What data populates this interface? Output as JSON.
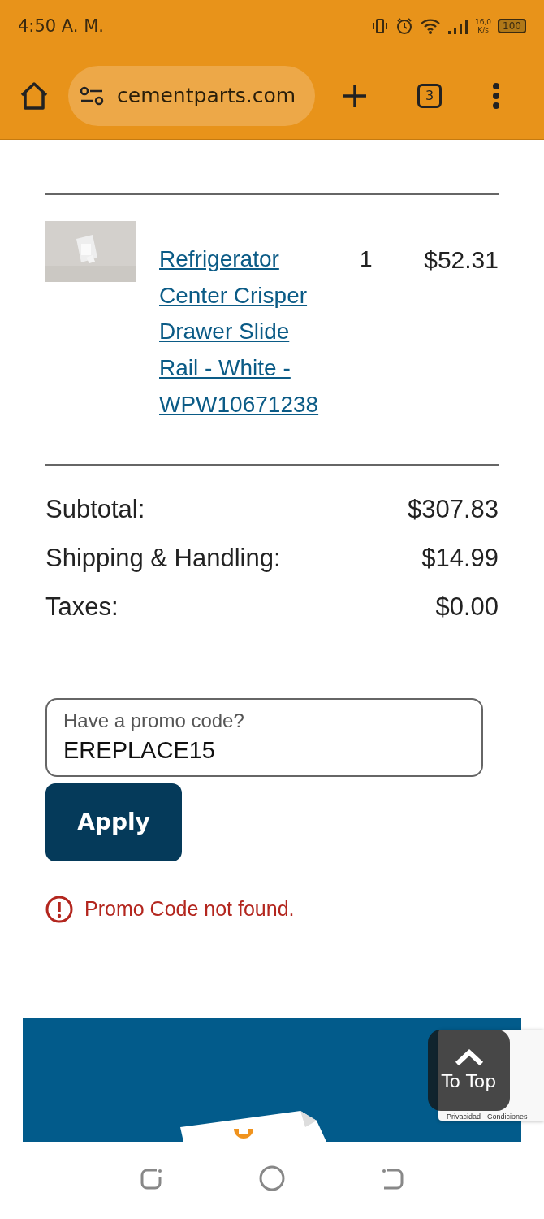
{
  "status_bar": {
    "time": "4:50 A. M.",
    "net_speed": "16,0",
    "net_unit": "K/s",
    "battery": "100"
  },
  "toolbar": {
    "url": "cementparts.com",
    "tab_count": "3"
  },
  "cart_item": {
    "product_name": "Refrigerator Center Crisper Drawer Slide Rail - White - WPW10671238",
    "quantity": "1",
    "price": "$52.31"
  },
  "summary": [
    {
      "label": "Subtotal:",
      "value": "$307.83"
    },
    {
      "label": "Shipping & Handling:",
      "value": "$14.99"
    },
    {
      "label": "Taxes:",
      "value": "$0.00"
    }
  ],
  "promo": {
    "label": "Have a promo code?",
    "value": "EREPLACE15",
    "button": "Apply",
    "error": "Promo Code not found."
  },
  "to_top": "To Top",
  "recaptcha": "Privacidad - Condiciones"
}
